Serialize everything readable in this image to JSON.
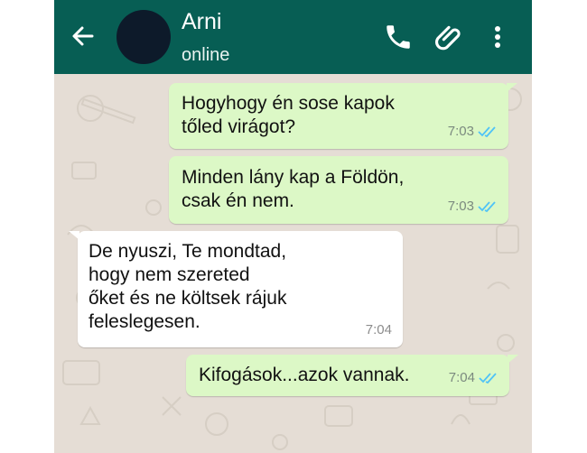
{
  "header": {
    "contact_name": "Arni",
    "status": "online",
    "back_icon": "back-arrow-icon",
    "call_icon": "phone-icon",
    "attach_icon": "paperclip-icon",
    "menu_icon": "more-vert-icon",
    "bar_color": "#075e54"
  },
  "messages": [
    {
      "direction": "outgoing",
      "text": "Hogyhogy én sose kapok\ntőled virágot?",
      "time": "7:03",
      "read": true
    },
    {
      "direction": "outgoing",
      "text": "Minden lány kap a Földön,\ncsak én nem.",
      "time": "7:03",
      "read": true
    },
    {
      "direction": "incoming",
      "text": "De nyuszi, Te mondtad,\nhogy nem szereted\nőket és ne költsek rájuk\nfeleslegesen.",
      "time": "7:04"
    },
    {
      "direction": "outgoing",
      "text": "Kifogások...azok vannak.",
      "time": "7:04",
      "read": true
    }
  ],
  "colors": {
    "outgoing_bubble": "#dcf8c6",
    "incoming_bubble": "#ffffff",
    "read_ticks": "#4fc3f7",
    "wallpaper": "#e5ddd5"
  }
}
